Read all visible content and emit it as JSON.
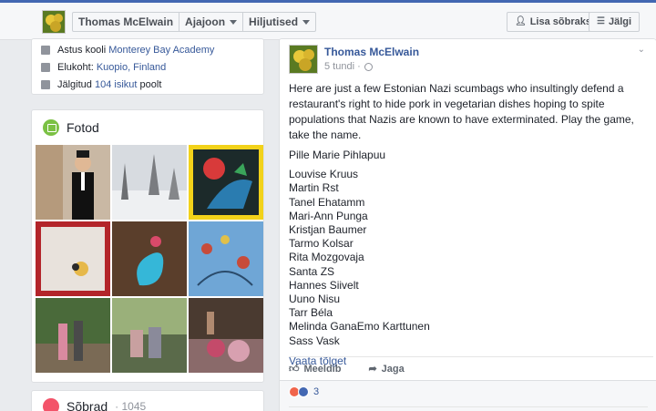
{
  "header": {
    "name": "Thomas McElwain",
    "timeline_label": "Ajajoon",
    "recent_label": "Hiljutised",
    "add_friend_label": "Lisa sõbraks",
    "follow_label": "Jälgi"
  },
  "intro": {
    "school_prefix": "Astus kooli ",
    "school": "Monterey Bay Academy",
    "home_prefix": "Elukoht: ",
    "home": "Kuopio, Finland",
    "followed_prefix": "Jälgitud ",
    "followed_count": "104 isikut",
    "followed_suffix": " poolt"
  },
  "photos": {
    "title": "Fotod"
  },
  "friends": {
    "title": "Sõbrad",
    "count": "· 1045"
  },
  "post": {
    "author": "Thomas McElwain",
    "time": "5 tundi ·",
    "text": "Here are just a few Estonian Nazi scumbags who insultingly defend a restaurant's right to hide pork in vegetarian dishes hoping to spite populations that Nazis are known to have exterminated. Play the game, take the name.",
    "names": [
      "Pille Marie Pihlapuu",
      "Louvise Kruus",
      "Martin Rst",
      "Tanel Ehatamm",
      "Mari-Ann Punga",
      "Kristjan Baumer",
      "Tarmo Kolsar",
      "Rita Mozgovaja",
      "Santa ZS",
      "Hannes Siivelt",
      "Uuno Nisu",
      "Tarr Béla",
      "Melinda GanaEmo Karttunen",
      "Sass Vask"
    ],
    "see_more": "Vaata tõlget",
    "like_label": "Meeldib",
    "share_label": "Jaga",
    "reaction_count": "3"
  },
  "colors": {
    "accent": "#4267b2",
    "link": "#365899",
    "photos_icon": "#7bc144",
    "friends_icon": "#f35369"
  }
}
